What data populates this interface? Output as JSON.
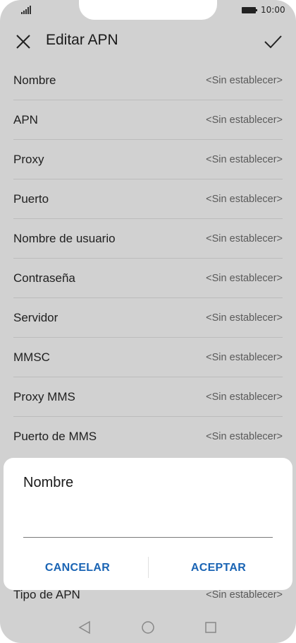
{
  "status_bar": {
    "time": "10:00",
    "signal_icon": "signal-icon",
    "battery_icon": "battery-icon"
  },
  "toolbar": {
    "title": "Editar APN",
    "close_icon": "close-icon",
    "confirm_icon": "check-icon"
  },
  "settings": {
    "items": [
      {
        "label": "Nombre",
        "value": "<Sin establecer>"
      },
      {
        "label": "APN",
        "value": "<Sin establecer>"
      },
      {
        "label": "Proxy",
        "value": "<Sin establecer>"
      },
      {
        "label": "Puerto",
        "value": "<Sin establecer>"
      },
      {
        "label": "Nombre de usuario",
        "value": "<Sin establecer>"
      },
      {
        "label": "Contraseña",
        "value": "<Sin establecer>"
      },
      {
        "label": "Servidor",
        "value": "<Sin establecer>"
      },
      {
        "label": "MMSC",
        "value": "<Sin establecer>"
      },
      {
        "label": "Proxy MMS",
        "value": "<Sin establecer>"
      },
      {
        "label": "Puerto de MMS",
        "value": "<Sin establecer>"
      }
    ],
    "bottom_item": {
      "label": "Tipo de APN",
      "value": "<Sin establecer>"
    }
  },
  "dialog": {
    "title": "Nombre",
    "input_value": "",
    "cancel_label": "CANCELAR",
    "accept_label": "ACEPTAR"
  },
  "colors": {
    "accent": "#1a64b4",
    "scrim_background": "#d1d1d1"
  },
  "nav_bar": {
    "back_icon": "back-triangle-icon",
    "home_icon": "home-circle-icon",
    "recent_icon": "recent-square-icon"
  }
}
